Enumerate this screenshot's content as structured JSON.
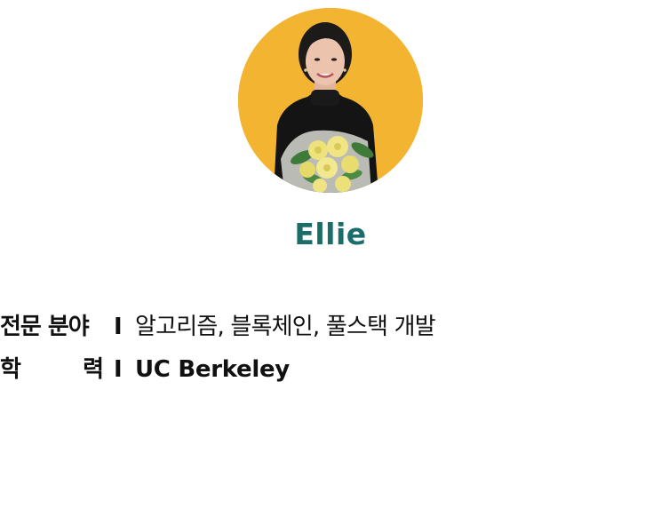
{
  "profile": {
    "name": "Ellie",
    "name_color": "#1b6d69",
    "avatar_background": "#f2b431",
    "avatar_icon": "profile-photo"
  },
  "info": {
    "rows": [
      {
        "label": "전문 분야",
        "separator": "I",
        "value": "알고리즘, 블록체인, 풀스택  개발"
      },
      {
        "label_chars": [
          "학",
          "력"
        ],
        "separator": "I",
        "value": "UC Berkeley"
      }
    ]
  }
}
